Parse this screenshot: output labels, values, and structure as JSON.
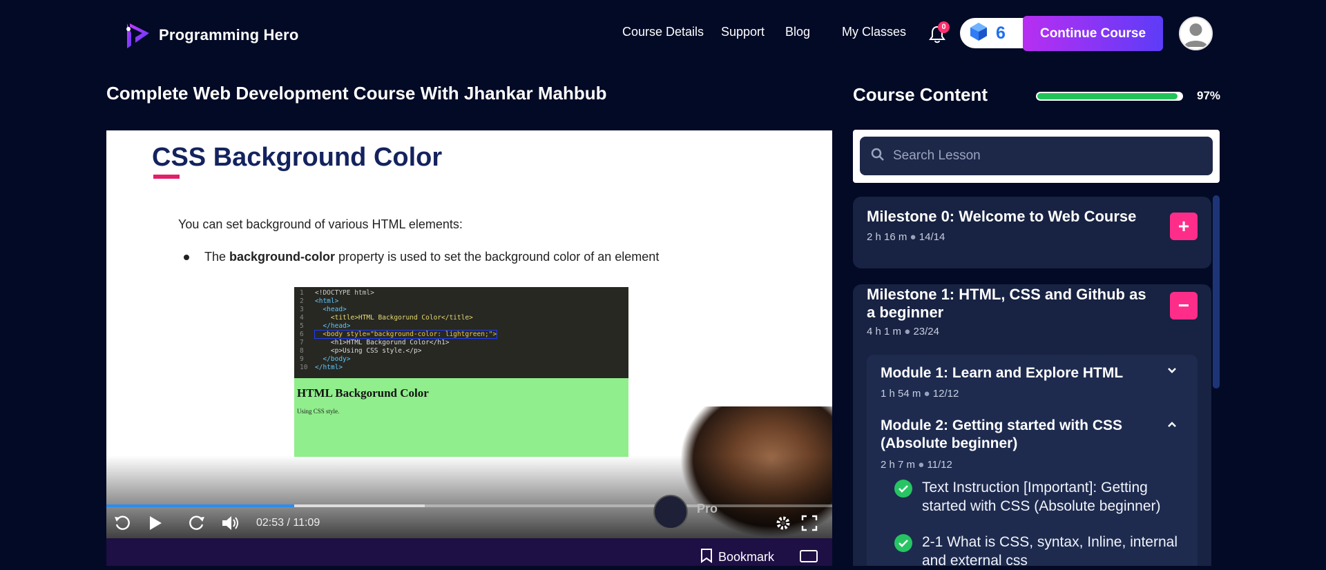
{
  "header": {
    "brand": "Programming Hero",
    "nav": [
      "Course Details",
      "Support",
      "Blog",
      "My Classes"
    ],
    "notification_count": "0",
    "gems_count": "6",
    "continue_label": "Continue Course"
  },
  "course": {
    "title": "Complete Web Development Course With Jhankar Mahbub"
  },
  "video": {
    "slide_title": "CSS Background Color",
    "slide_line1": "You can set background of various HTML elements:",
    "slide_bullet_pre": "The ",
    "slide_bullet_bold": "background-color",
    "slide_bullet_post": " property is used to set the background color of an element",
    "code_lines": [
      "<!DOCTYPE html>",
      "<html>",
      "  <head>",
      "    <title>HTML Backgorund Color</title>",
      "  </head>",
      "  <body style=\"background-color: lightgreen;\">",
      "    <h1>HTML Backgorund Color</h1>",
      "    <p>Using CSS style.</p>",
      "  </body>",
      "</html>"
    ],
    "result_heading": "HTML Backgorund Color",
    "result_text": "Using CSS style.",
    "watermark": "Pro",
    "time": "02:53 / 11:09",
    "played_fraction": 0.259,
    "buffered_fraction": 0.439,
    "bookmark_label": "Bookmark"
  },
  "sidebar": {
    "heading": "Course Content",
    "progress_percent": 97,
    "progress_label": "97%",
    "search_placeholder": "Search Lesson",
    "milestones": [
      {
        "title": "Milestone 0: Welcome to Web Course",
        "duration": "2 h 16 m",
        "progress": "14/14",
        "toggle": "+"
      },
      {
        "title": "Milestone 1: HTML, CSS and Github as a beginner",
        "duration": "4 h 1 m",
        "progress": "23/24",
        "toggle": "−"
      }
    ],
    "modules": [
      {
        "title": "Module 1: Learn and Explore HTML",
        "duration": "1 h 54 m",
        "progress": "12/12"
      },
      {
        "title": "Module 2: Getting started with CSS (Absolute beginner)",
        "duration": "2 h 7 m",
        "progress": "11/12"
      }
    ],
    "lessons": [
      {
        "title": "Text Instruction [Important]: Getting started with CSS (Absolute beginner)"
      },
      {
        "title": "2-1 What is CSS, syntax, Inline, internal and external css"
      }
    ]
  },
  "colors": {
    "accent_pink": "#ff2d8a",
    "progress_green": "#24c35a",
    "video_progress": "#2a8df0",
    "background": "#030a26"
  }
}
